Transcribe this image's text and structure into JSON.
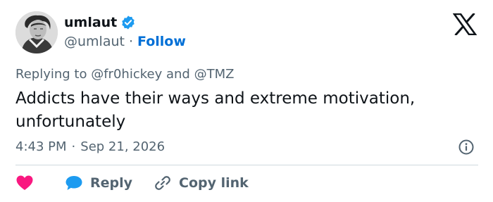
{
  "author": {
    "display_name": "umlaut",
    "handle": "@umlaut",
    "separator": "·",
    "follow_label": "Follow"
  },
  "reply_context": {
    "prefix": "Replying to",
    "mention_1": "@fr0hickey",
    "conjunction": "and",
    "mention_2": "@TMZ"
  },
  "tweet": {
    "text": "Addicts have their ways and extreme motivation, unfortunately",
    "time": "4:43 PM",
    "separator": "·",
    "date": "Sep 21, 2026"
  },
  "actions": {
    "reply_label": "Reply",
    "copy_link_label": "Copy link"
  },
  "icons": {
    "verified": "verified-badge-icon",
    "x_logo": "x-logo-icon",
    "info": "info-icon",
    "heart": "heart-icon",
    "reply": "reply-bubble-icon",
    "link": "link-icon"
  },
  "colors": {
    "text": "#0f1419",
    "secondary": "#536471",
    "follow": "#006fd6",
    "verified": "#1d9bf0",
    "heart": "#f91880",
    "reply_bubble": "#1d9bf0",
    "divider": "#cfd9de"
  }
}
